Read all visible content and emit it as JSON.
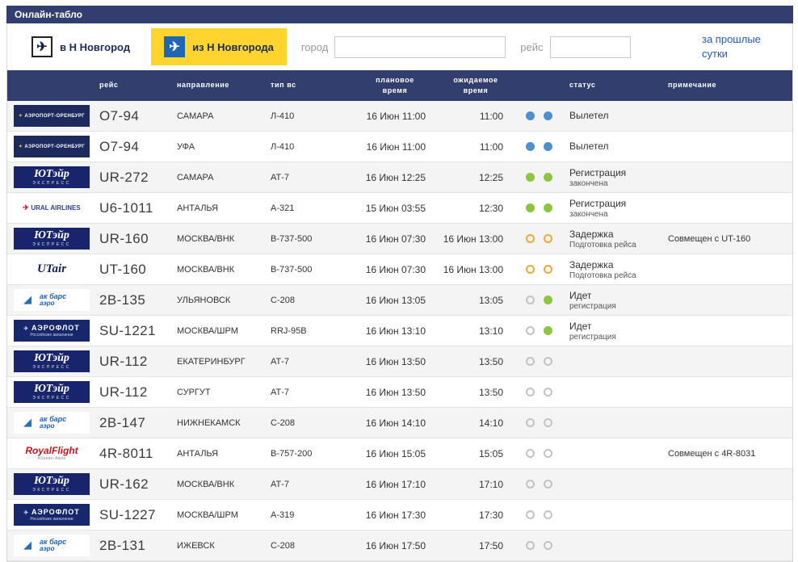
{
  "header": {
    "title": "Онлайн-табло"
  },
  "toolbar": {
    "tab_to": "в Н Новгород",
    "tab_from": "из Н Новгорода",
    "city_label": "город",
    "city_value": "",
    "flight_label": "рейс",
    "flight_value": "",
    "history_link": "за прошлые сутки"
  },
  "table": {
    "columns": {
      "flight": "рейс",
      "direction": "направление",
      "aircraft": "тип вс",
      "planned": "плановое\nвремя",
      "expected": "ожидаемое\nвремя",
      "status": "статус",
      "note": "примечание"
    },
    "rows": [
      {
        "airline": "orenburg",
        "flight": "О7-94",
        "direction": "САМАРА",
        "aircraft": "Л-410",
        "planned": "16 Июн 11:00",
        "expected": "11:00",
        "dots": [
          "blue",
          "blue"
        ],
        "status": "Вылетел",
        "status_detail": "",
        "note": ""
      },
      {
        "airline": "orenburg",
        "flight": "О7-94",
        "direction": "УФА",
        "aircraft": "Л-410",
        "planned": "16 Июн 11:00",
        "expected": "11:00",
        "dots": [
          "blue",
          "blue"
        ],
        "status": "Вылетел",
        "status_detail": "",
        "note": ""
      },
      {
        "airline": "utair_ru",
        "flight": "UR-272",
        "direction": "САМАРА",
        "aircraft": "АТ-7",
        "planned": "16 Июн 12:25",
        "expected": "12:25",
        "dots": [
          "green",
          "green"
        ],
        "status": "Регистрация",
        "status_detail": "закончена",
        "note": ""
      },
      {
        "airline": "ural",
        "flight": "U6-1011",
        "direction": "АНТАЛЬЯ",
        "aircraft": "А-321",
        "planned": "15 Июн 03:55",
        "expected": "12:30",
        "dots": [
          "green",
          "green"
        ],
        "status": "Регистрация",
        "status_detail": "закончена",
        "note": ""
      },
      {
        "airline": "utair_ru",
        "flight": "UR-160",
        "direction": "МОСКВА/ВНК",
        "aircraft": "В-737-500",
        "planned": "16 Июн 07:30",
        "expected": "16 Июн 13:00",
        "dots": [
          "orange",
          "orange"
        ],
        "status": "Задержка",
        "status_detail": "Подготовка рейса",
        "note": "Совмещен с UT-160"
      },
      {
        "airline": "utair_lat",
        "flight": "UT-160",
        "direction": "МОСКВА/ВНК",
        "aircraft": "В-737-500",
        "planned": "16 Июн 07:30",
        "expected": "16 Июн 13:00",
        "dots": [
          "orange",
          "orange"
        ],
        "status": "Задержка",
        "status_detail": "Подготовка рейса",
        "note": ""
      },
      {
        "airline": "akbars",
        "flight": "2В-135",
        "direction": "УЛЬЯНОВСК",
        "aircraft": "С-208",
        "planned": "16 Июн 13:05",
        "expected": "13:05",
        "dots": [
          "gray",
          "green"
        ],
        "status": "Идет",
        "status_detail": "регистрация",
        "note": ""
      },
      {
        "airline": "aeroflot",
        "flight": "SU-1221",
        "direction": "МОСКВА/ШРМ",
        "aircraft": "RRJ-95B",
        "planned": "16 Июн 13:10",
        "expected": "13:10",
        "dots": [
          "gray",
          "green"
        ],
        "status": "Идет",
        "status_detail": "регистрация",
        "note": ""
      },
      {
        "airline": "utair_ru",
        "flight": "UR-112",
        "direction": "ЕКАТЕРИНБУРГ",
        "aircraft": "АТ-7",
        "planned": "16 Июн 13:50",
        "expected": "13:50",
        "dots": [
          "gray",
          "gray"
        ],
        "status": "",
        "status_detail": "",
        "note": ""
      },
      {
        "airline": "utair_ru",
        "flight": "UR-112",
        "direction": "СУРГУТ",
        "aircraft": "АТ-7",
        "planned": "16 Июн 13:50",
        "expected": "13:50",
        "dots": [
          "gray",
          "gray"
        ],
        "status": "",
        "status_detail": "",
        "note": ""
      },
      {
        "airline": "akbars",
        "flight": "2В-147",
        "direction": "НИЖНЕКАМСК",
        "aircraft": "С-208",
        "planned": "16 Июн 14:10",
        "expected": "14:10",
        "dots": [
          "gray",
          "gray"
        ],
        "status": "",
        "status_detail": "",
        "note": ""
      },
      {
        "airline": "royalflight",
        "flight": "4R-8011",
        "direction": "АНТАЛЬЯ",
        "aircraft": "В-757-200",
        "planned": "16 Июн 15:05",
        "expected": "15:05",
        "dots": [
          "gray",
          "gray"
        ],
        "status": "",
        "status_detail": "",
        "note": "Совмещен с 4R-8031"
      },
      {
        "airline": "utair_ru",
        "flight": "UR-162",
        "direction": "МОСКВА/ВНК",
        "aircraft": "АТ-7",
        "planned": "16 Июн 17:10",
        "expected": "17:10",
        "dots": [
          "gray",
          "gray"
        ],
        "status": "",
        "status_detail": "",
        "note": ""
      },
      {
        "airline": "aeroflot",
        "flight": "SU-1227",
        "direction": "МОСКВА/ШРМ",
        "aircraft": "А-319",
        "planned": "16 Июн 17:30",
        "expected": "17:30",
        "dots": [
          "gray",
          "gray"
        ],
        "status": "",
        "status_detail": "",
        "note": ""
      },
      {
        "airline": "akbars",
        "flight": "2В-131",
        "direction": "ИЖЕВСК",
        "aircraft": "С-208",
        "planned": "16 Июн 17:50",
        "expected": "17:50",
        "dots": [
          "gray",
          "gray"
        ],
        "status": "",
        "status_detail": "",
        "note": ""
      }
    ]
  },
  "logos": {
    "orenburg": {
      "main": "АЭРОПОРТ-ОРЕНБУРГ",
      "sub": ""
    },
    "utair_ru": {
      "main": "ЮТэйр",
      "sub": "ЭКСПРЕСС"
    },
    "ural": {
      "main": "URAL AIRLINES",
      "sub": ""
    },
    "utair_lat": {
      "main": "UTair",
      "sub": ""
    },
    "akbars": {
      "main": "ак барс",
      "sub": "аэро"
    },
    "aeroflot": {
      "main": "АЭРОФЛОТ",
      "sub": "Российские авиалинии"
    },
    "royalflight": {
      "main": "RoyalFlight",
      "sub": "Абакан-Авиа"
    }
  },
  "colors": {
    "header_bg": "#323F6E",
    "active_tab": "#FFD42E",
    "link": "#2758BA",
    "dot_departed_blue": "#4E8FD0",
    "dot_done_green": "#8CC63E",
    "dot_delay_orange": "#EEA83C",
    "dot_pending_gray": "#C3C3C3"
  }
}
